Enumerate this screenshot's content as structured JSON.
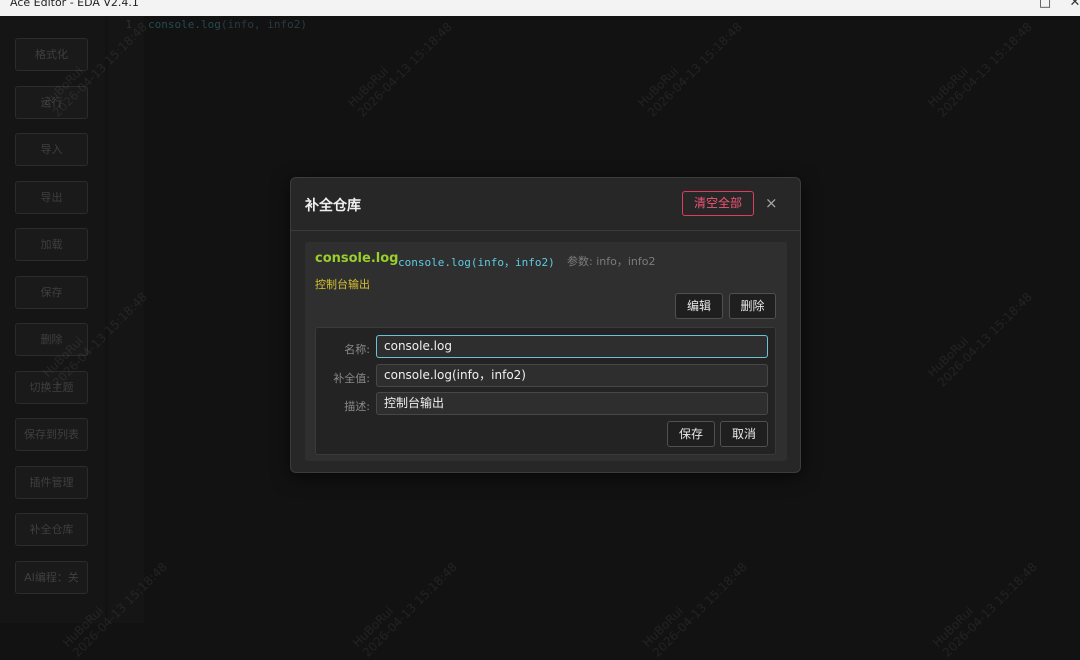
{
  "window": {
    "title": "Ace Editor - EDA V2.4.1",
    "controls": [
      "^",
      "□",
      "✕"
    ]
  },
  "sidebar": {
    "items": [
      "格式化",
      "运行",
      "导入",
      "导出",
      "加载",
      "保存",
      "删除",
      "切换主题",
      "保存到列表",
      "插件管理",
      "补全仓库",
      "AI编程：关"
    ]
  },
  "editor": {
    "line_number": "1",
    "code_fn": "console.log",
    "code_args": "(info, info2)"
  },
  "watermark": {
    "name": "HuBoRui",
    "date": "2026-04-13 15:18:48"
  },
  "modal": {
    "title": "补全仓库",
    "clear_all_label": "清空全部",
    "close_label": "×",
    "entry": {
      "name": "console.log",
      "value": "console.log(info，info2)",
      "params": "参数: info，info2",
      "description": "控制台输出",
      "edit_label": "编辑",
      "delete_label": "删除"
    },
    "form": {
      "name_label": "名称:",
      "name_value": "console.log",
      "value_label": "补全值:",
      "value_value": "console.log(info，info2)",
      "desc_label": "描述:",
      "desc_value": "控制台输出",
      "save_label": "保存",
      "cancel_label": "取消"
    }
  },
  "colors": {
    "entry_name": "#98cf2a",
    "entry_value": "#5fcbe0",
    "entry_description": "#d6c030",
    "clear_button": "#e03c5e",
    "focus_border": "#6cc1d6"
  }
}
